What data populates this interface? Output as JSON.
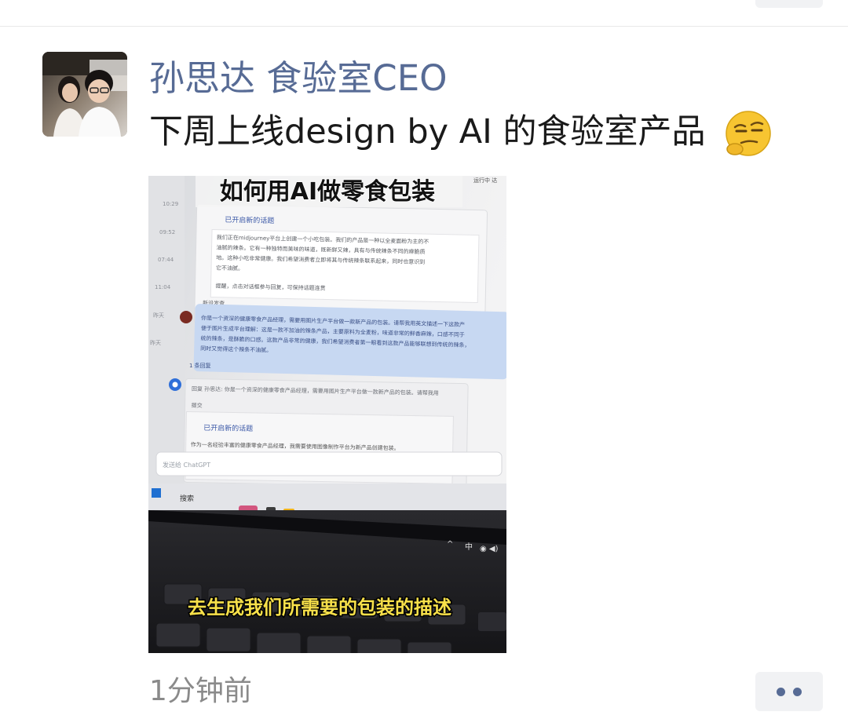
{
  "post": {
    "author": "孙思达 食验室CEO",
    "text": "下周上线design by AI 的食验室产品",
    "emoji_icon": "smirk-thinking-emoji",
    "timestamp": "1分钟前",
    "more_icon": "more-dots-icon"
  },
  "photo": {
    "caption_top": "如何用AI做零食包装",
    "caption_bottom": "去生成我们所需要的包装的描述",
    "chat": {
      "times": [
        "10:29",
        "09:52",
        "07:44",
        "11:04",
        "昨天",
        "昨天"
      ],
      "topic_label": "已开启新的话题",
      "card1_lines": [
        "我们正在midjourney平台上创建一个小吃包装。我们的产品是一种以全麦面粉为主的不",
        "油腻的辣条。它有一种独特而美味的味道，既新鲜又辣，具有与传统辣条不同的麻脆质",
        "地。这种小吃非常健康。我们希望消费者立即将其与传统辣条联系起来，同时也意识到",
        "它不油腻。"
      ],
      "card1_hint": "提醒，点击对话框参与回复，可保持话题连贯",
      "card1_action": "新设发查",
      "bubble_lines": [
        "你是一个资深的健康零食产品经理，需要用图片生产平台做一款新产品的包装。请帮我用英文描述一下这款产",
        "便于图片生成平台理解：这是一款不加油的辣条产品，主要原料为全麦粉，味道非常的鲜香麻辣，口感不同于",
        "统的辣条，是酥脆的口感。这款产品非常的健康，我们希望消费者第一眼看到这款产品能够联想到传统的辣条，",
        "同时又觉得这个辣条不油腻。"
      ],
      "reply_count": "1 条回复",
      "card2_quote": "回复 孙思达: 你是一个资深的健康零食产品经理，需要用图片生产平台做一款新产品的包装。请帮我用",
      "card2_label": "提交",
      "card2_topic": "已开启新的话题",
      "card2_line": "作为一名经验丰富的健康零食产品经理，我需要使用图像制作平台为新产品创建包装。",
      "input_placeholder": "发送给 ChatGPT",
      "taskbar_search": "搜索",
      "tray_text": "中",
      "top_right_text": "运行中 达"
    }
  }
}
